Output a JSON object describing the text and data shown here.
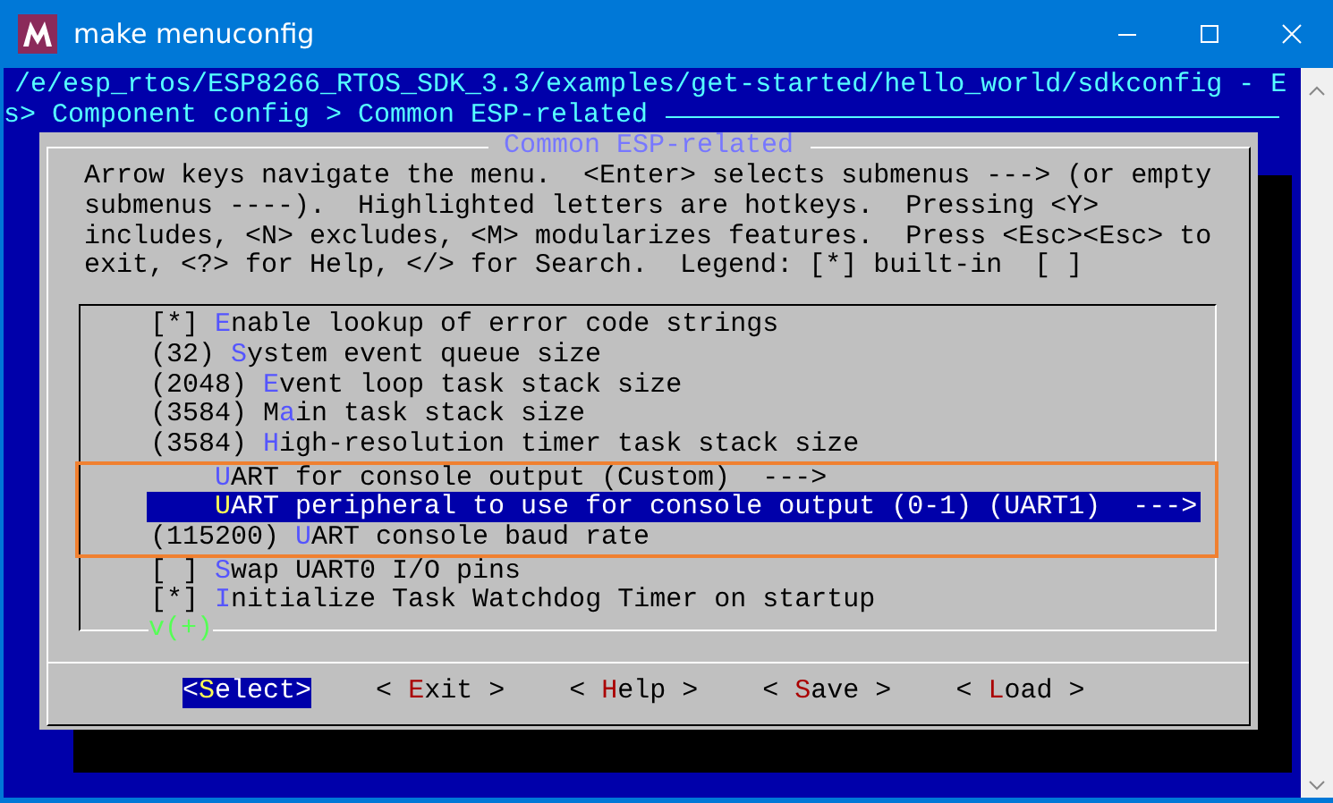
{
  "window": {
    "title": "make menuconfig"
  },
  "terminal": {
    "path_line": "/e/esp_rtos/ESP8266_RTOS_SDK_3.3/examples/get-started/hello_world/sdkconfig - E",
    "breadcrumb": "s> Component config > Common ESP-related"
  },
  "dialog": {
    "title": "Common ESP-related",
    "help": [
      "Arrow keys navigate the menu.  <Enter> selects submenus ---> (or empty",
      "submenus ----).  Highlighted letters are hotkeys.  Pressing <Y>",
      "includes, <N> excludes, <M> modularizes features.  Press <Esc><Esc> to",
      "exit, <?> for Help, </> for Search.  Legend: [*] built-in  [ ]"
    ],
    "items": [
      {
        "kind": "option",
        "before": "[*] ",
        "hotkey": "E",
        "after": "nable lookup of error code strings",
        "selected": false,
        "annotated": false
      },
      {
        "kind": "option",
        "before": "(32) ",
        "hotkey": "S",
        "after": "ystem event queue size",
        "selected": false,
        "annotated": false
      },
      {
        "kind": "option",
        "before": "(2048) ",
        "hotkey": "E",
        "after": "vent loop task stack size",
        "selected": false,
        "annotated": false
      },
      {
        "kind": "option",
        "before": "(3584) M",
        "hotkey": "a",
        "after": "in task stack size",
        "selected": false,
        "annotated": false
      },
      {
        "kind": "option",
        "before": "(3584) ",
        "hotkey": "H",
        "after": "igh-resolution timer task stack size",
        "selected": false,
        "annotated": false
      },
      {
        "kind": "choice",
        "hotkey": "U",
        "after": "ART for console output (Custom)  --->",
        "selected": false,
        "annotated": true
      },
      {
        "kind": "choice",
        "hotkey": "U",
        "after": "ART peripheral to use for console output (0-1) (UART1)  --->",
        "selected": true,
        "annotated": true
      },
      {
        "kind": "option",
        "before": "(115200) ",
        "hotkey": "U",
        "after": "ART console baud rate",
        "selected": false,
        "annotated": true
      },
      {
        "kind": "option",
        "before": "[ ] ",
        "hotkey": "S",
        "after": "wap UART0 I/O pins",
        "selected": false,
        "annotated": false
      },
      {
        "kind": "option",
        "before": "[*] ",
        "hotkey": "I",
        "after": "nitialize Task Watchdog Timer on startup",
        "selected": false,
        "annotated": false
      }
    ],
    "more_indicator": "v(+)",
    "buttons": [
      {
        "before": "<",
        "hotkey": "S",
        "after": "elect>",
        "selected": true
      },
      {
        "before": "< ",
        "hotkey": "E",
        "after": "xit >",
        "selected": false
      },
      {
        "before": "< ",
        "hotkey": "H",
        "after": "elp >",
        "selected": false
      },
      {
        "before": "< ",
        "hotkey": "S",
        "after": "ave >",
        "selected": false
      },
      {
        "before": "< ",
        "hotkey": "L",
        "after": "oad >",
        "selected": false
      }
    ]
  }
}
